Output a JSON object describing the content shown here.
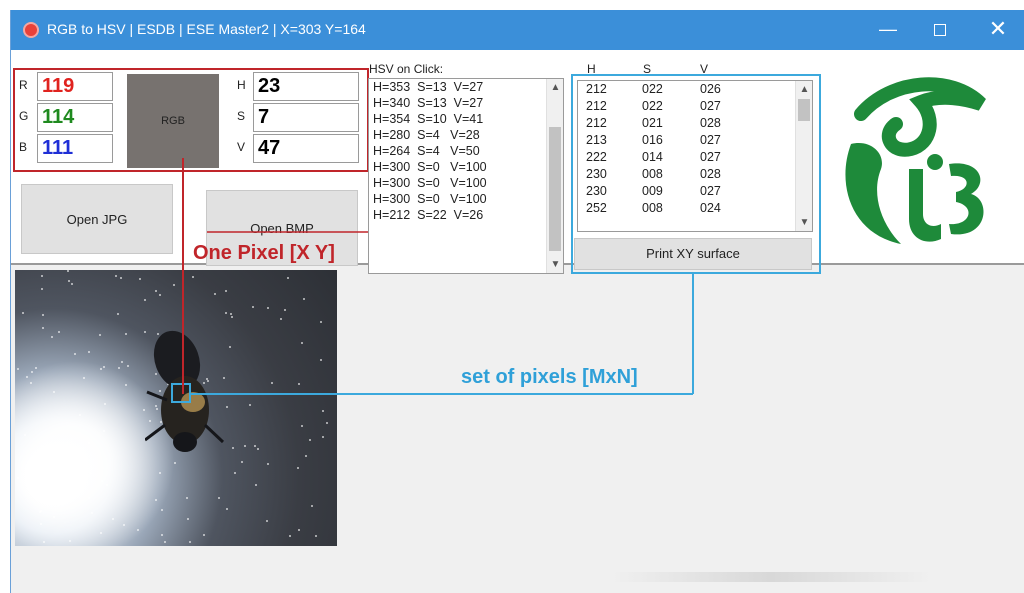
{
  "window": {
    "title": "RGB to HSV |  ESDB | ESE Master2 | X=303 Y=164",
    "minimize_glyph": "—",
    "close_glyph": "✕"
  },
  "rgb_panel": {
    "r_label": "R",
    "r_value": "119",
    "r_color": "#e0231f",
    "g_label": "G",
    "g_value": "114",
    "g_color": "#1f8a1f",
    "b_label": "B",
    "b_value": "111",
    "b_color": "#1f2fd6",
    "swatch_label": "RGB",
    "swatch_color": "#77726f"
  },
  "hsv_panel": {
    "h_label": "H",
    "h_value": "23",
    "s_label": "S",
    "s_value": "7",
    "v_label": "V",
    "v_value": "47"
  },
  "buttons": {
    "open_jpg": "Open JPG",
    "open_bmp": "Open BMP",
    "print_xy": "Print XY surface"
  },
  "hsv_on_click": {
    "label": "HSV on Click:",
    "lines": [
      "H=353  S=13  V=27",
      "H=340  S=13  V=27",
      "H=354  S=10  V=41",
      "H=280  S=4   V=28",
      "H=264  S=4   V=50",
      "H=300  S=0   V=100",
      "H=300  S=0   V=100",
      "H=300  S=0   V=100",
      "H=212  S=22  V=26"
    ]
  },
  "xy_surface": {
    "headers": [
      "H",
      "S",
      "V"
    ],
    "rows": [
      [
        "212",
        "022",
        "026"
      ],
      [
        "212",
        "022",
        "027"
      ],
      [
        "212",
        "021",
        "028"
      ],
      [
        "213",
        "016",
        "027"
      ],
      [
        "222",
        "014",
        "027"
      ],
      [
        "230",
        "008",
        "028"
      ],
      [
        "230",
        "009",
        "027"
      ],
      [
        "252",
        "008",
        "024"
      ]
    ]
  },
  "annotations": {
    "one_pixel": "One Pixel [X Y]",
    "set_of_pixels": "set of pixels [MxN]"
  },
  "colors": {
    "annotation_red": "#c0252a",
    "annotation_blue": "#3ca9dd",
    "titlebar": "#3b8fd9",
    "logo_green": "#1e8a3a"
  },
  "icons": {
    "app": "app-icon",
    "scroll_up": "scroll-up-icon",
    "scroll_down": "scroll-down-icon",
    "logo": "university-logo"
  }
}
